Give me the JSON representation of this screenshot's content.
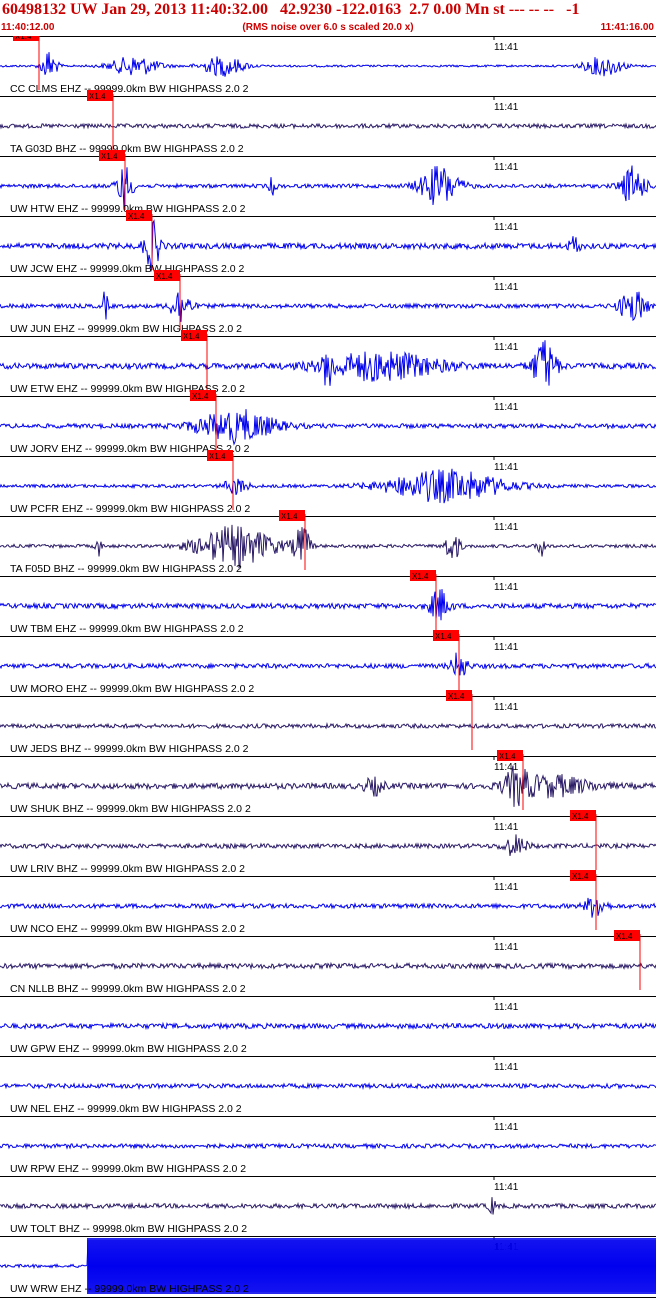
{
  "header": {
    "title": "60498132 UW Jan 29, 2013 11:40:32.00   42.9230 -122.0163  2.7 0.00 Mn st --- -- --   -1",
    "start_time": "11:40:12.00",
    "noise_note": "(RMS noise over 6.0 s scaled 20.0 x)",
    "end_time": "11:41:16.00"
  },
  "colors": {
    "title": "#cc0000",
    "trace_blue": "#0000ee",
    "trace_purple": "#2a1a66",
    "pick": "#ff0000",
    "frame": "#000000",
    "background": "#ffffff"
  },
  "chart_data": {
    "type": "line",
    "x_range": [
      "11:40:12.00",
      "11:41:16.00"
    ],
    "minute_tick_label": "11:41",
    "pick_label": "X1.4",
    "traces": [
      {
        "label": "CC CLMS EHZ -- 99999.0km BW  HIGHPASS  2.0  2",
        "color": "blue",
        "pick": 0.06,
        "noise": 0.0,
        "bursts": [
          [
            0.075,
            0.008,
            16
          ],
          [
            0.205,
            0.025,
            10
          ],
          [
            0.34,
            0.022,
            10
          ],
          [
            0.92,
            0.02,
            10
          ]
        ]
      },
      {
        "label": "TA G03D BHZ -- 99999.0km BW  HIGHPASS  2.0  2",
        "color": "purple",
        "pick": 0.173,
        "noise": 0.18,
        "bursts": []
      },
      {
        "label": "UW HTW EHZ -- 99999.0km BW  HIGHPASS  2.0  2",
        "color": "blue",
        "pick": 0.19,
        "noise": 0.15,
        "bursts": [
          [
            0.19,
            0.008,
            22
          ],
          [
            0.415,
            0.004,
            8
          ],
          [
            0.67,
            0.02,
            20
          ],
          [
            0.965,
            0.012,
            20
          ]
        ]
      },
      {
        "label": "UW JCW EHZ -- 99999.0km BW  HIGHPASS  2.0  2",
        "color": "blue",
        "pick": 0.232,
        "noise": 0.3,
        "bursts": [
          [
            0.232,
            0.008,
            24
          ],
          [
            0.875,
            0.005,
            10
          ]
        ]
      },
      {
        "label": "UW JUN EHZ -- 99999.0km BW  HIGHPASS  2.0  2",
        "color": "blue",
        "pick": 0.275,
        "noise": 0.18,
        "bursts": [
          [
            0.16,
            0.003,
            14
          ],
          [
            0.275,
            0.01,
            18
          ],
          [
            0.965,
            0.014,
            16
          ]
        ]
      },
      {
        "label": "UW ETW EHZ -- 99999.0km BW  HIGHPASS  2.0  2",
        "color": "blue",
        "pick": 0.315,
        "noise": 0.3,
        "bursts": [
          [
            0.5,
            0.004,
            24
          ],
          [
            0.58,
            0.06,
            14
          ],
          [
            0.83,
            0.012,
            26
          ]
        ]
      },
      {
        "label": "UW JORV EHZ -- 99999.0km BW  HIGHPASS  2.0  2",
        "color": "blue",
        "pick": 0.33,
        "noise": 0.2,
        "bursts": [
          [
            0.36,
            0.04,
            16
          ]
        ]
      },
      {
        "label": "UW PCFR EHZ -- 99999.0km BW  HIGHPASS  2.0  2",
        "color": "blue",
        "pick": 0.355,
        "noise": 0.1,
        "bursts": [
          [
            0.36,
            0.012,
            8
          ],
          [
            0.68,
            0.06,
            16
          ]
        ]
      },
      {
        "label": "TA F05D BHZ -- 99999.0km BW  HIGHPASS  2.0  2",
        "color": "purple",
        "pick": 0.465,
        "noise": 0.1,
        "bursts": [
          [
            0.15,
            0.003,
            10
          ],
          [
            0.36,
            0.04,
            20
          ],
          [
            0.46,
            0.008,
            22
          ],
          [
            0.555,
            0.003,
            8
          ],
          [
            0.69,
            0.008,
            14
          ],
          [
            0.825,
            0.004,
            12
          ]
        ]
      },
      {
        "label": "UW TBM EHZ -- 99999.0km BW  HIGHPASS  2.0  2",
        "color": "blue",
        "pick": 0.665,
        "noise": 0.25,
        "bursts": [
          [
            0.67,
            0.01,
            16
          ]
        ]
      },
      {
        "label": "UW MORO EHZ -- 99999.0km BW  HIGHPASS  2.0  2",
        "color": "blue",
        "pick": 0.7,
        "noise": 0.22,
        "bursts": [
          [
            0.7,
            0.008,
            14
          ]
        ]
      },
      {
        "label": "UW JEDS BHZ -- 99999.0km BW  HIGHPASS  2.0  2",
        "color": "purple",
        "pick": 0.72,
        "noise": 0.18,
        "bursts": []
      },
      {
        "label": "UW SHUK BHZ -- 99999.0km BW  HIGHPASS  2.0  2",
        "color": "purple",
        "pick": 0.797,
        "noise": 0.3,
        "bursts": [
          [
            0.57,
            0.01,
            8
          ],
          [
            0.787,
            0.012,
            16
          ],
          [
            0.84,
            0.04,
            10
          ]
        ]
      },
      {
        "label": "UW LRIV BHZ -- 99999.0km BW  HIGHPASS  2.0  2",
        "color": "purple",
        "pick": 0.908,
        "noise": 0.2,
        "bursts": [
          [
            0.785,
            0.012,
            10
          ]
        ]
      },
      {
        "label": "UW NCO EHZ -- 99999.0km BW  HIGHPASS  2.0  2",
        "color": "blue",
        "pick": 0.908,
        "noise": 0.2,
        "bursts": [
          [
            0.908,
            0.01,
            12
          ]
        ]
      },
      {
        "label": "CN NLLB BHZ -- 99999.0km BW  HIGHPASS  2.0  2",
        "color": "purple",
        "pick": 0.975,
        "noise": 0.25,
        "bursts": []
      },
      {
        "label": "UW GPW EHZ -- 99999.0km BW  HIGHPASS  2.0  2",
        "color": "blue",
        "pick": null,
        "noise": 0.25,
        "bursts": []
      },
      {
        "label": "UW NEL EHZ -- 99999.0km BW  HIGHPASS  2.0  2",
        "color": "blue",
        "pick": null,
        "noise": 0.2,
        "bursts": []
      },
      {
        "label": "UW RPW EHZ -- 99999.0km BW  HIGHPASS  2.0  2",
        "color": "blue",
        "pick": null,
        "noise": 0.18,
        "bursts": []
      },
      {
        "label": "UW TOLT BHZ -- 99998.0km BW  HIGHPASS  2.0  2",
        "color": "purple",
        "pick": null,
        "noise": 0.2,
        "bursts": [
          [
            0.75,
            0.004,
            8
          ]
        ]
      },
      {
        "label": "UW WRW EHZ -- 99999.0km BW  HIGHPASS  2.0  2",
        "color": "blue",
        "pick": null,
        "noise": 0.1,
        "bursts": [],
        "saturated_from": 0.133
      }
    ]
  }
}
